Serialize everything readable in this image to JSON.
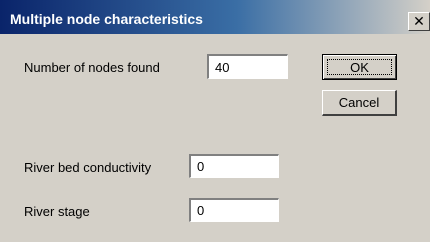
{
  "dialog": {
    "title": "Multiple node characteristics",
    "close_glyph": "✕"
  },
  "fields": {
    "nodes_found": {
      "label": "Number of nodes found",
      "value": "40"
    },
    "river_bed_conductivity": {
      "label": "River bed conductivity",
      "value": "0"
    },
    "river_stage": {
      "label": "River stage",
      "value": "0"
    }
  },
  "buttons": {
    "ok_label": "OK",
    "cancel_label": "Cancel"
  },
  "colors": {
    "title_gradient_start": "#0a246a",
    "title_gradient_end": "#d4d0c8",
    "dialog_background": "#d4d0c8"
  }
}
